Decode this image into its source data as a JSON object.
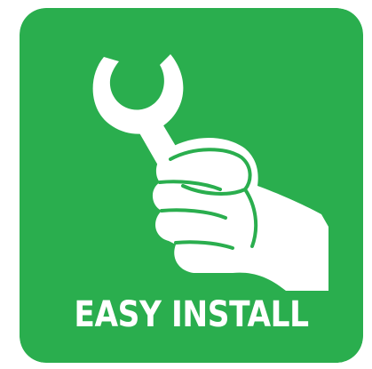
{
  "badge": {
    "label": "EASY INSTALL",
    "icon": "hand-holding-wrench-icon",
    "background_color": "#2aae4e",
    "foreground_color": "#ffffff"
  }
}
